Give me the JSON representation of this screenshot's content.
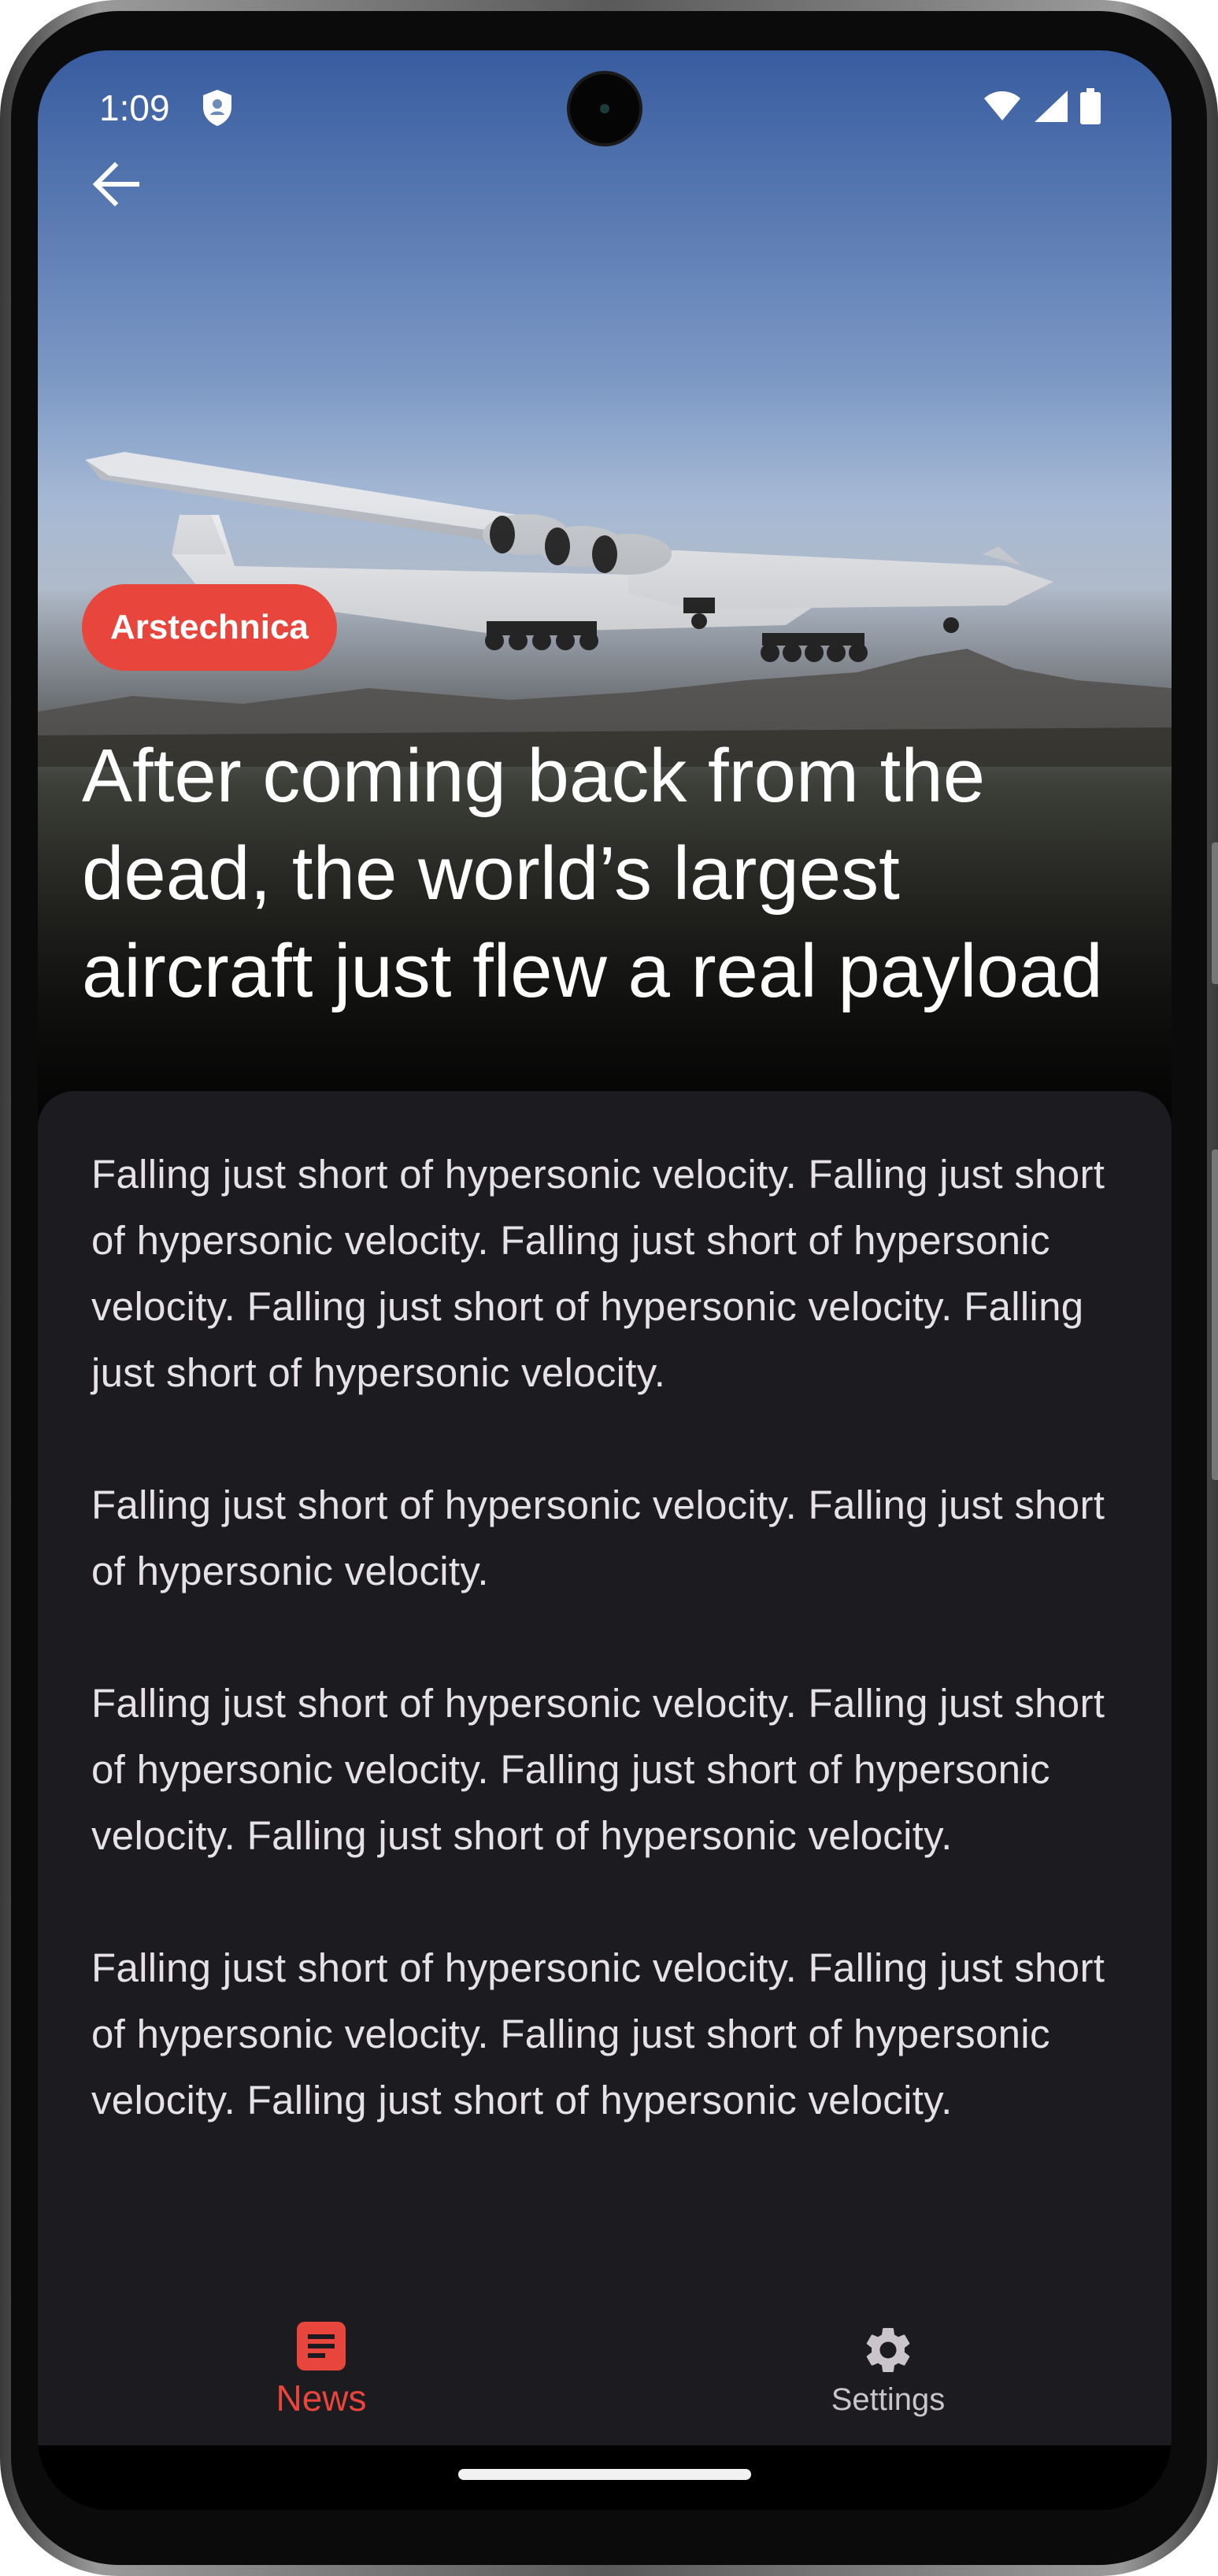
{
  "status_bar": {
    "time": "1:09",
    "icons": [
      "shield-icon",
      "wifi-icon",
      "cellular-signal-icon",
      "battery-icon"
    ]
  },
  "header": {
    "back_icon": "arrow-left-icon"
  },
  "article": {
    "source": "Arstechnica",
    "title": "After coming back from the dead, the world’s largest aircraft just flew a real payload",
    "paragraphs": [
      "Falling just short of hypersonic velocity. Falling just short of hypersonic velocity. Falling just short of hypersonic velocity. Falling just short of hypersonic velocity. Falling just short of hypersonic velocity.",
      "Falling just short of hypersonic velocity. Falling just short of hypersonic velocity.",
      "Falling just short of hypersonic velocity. Falling just short of hypersonic velocity. Falling just short of hypersonic velocity. Falling just short of hypersonic velocity.",
      "Falling just short of hypersonic velocity. Falling just short of hypersonic velocity. Falling just short of hypersonic velocity. Falling just short of hypersonic velocity."
    ]
  },
  "bottom_nav": {
    "items": [
      {
        "label": "News",
        "icon": "newspaper-icon",
        "active": true
      },
      {
        "label": "Settings",
        "icon": "gear-icon",
        "active": false
      }
    ]
  },
  "colors": {
    "accent": "#e8453c",
    "surface": "#1c1b1f",
    "text": "#e6e1e5"
  }
}
